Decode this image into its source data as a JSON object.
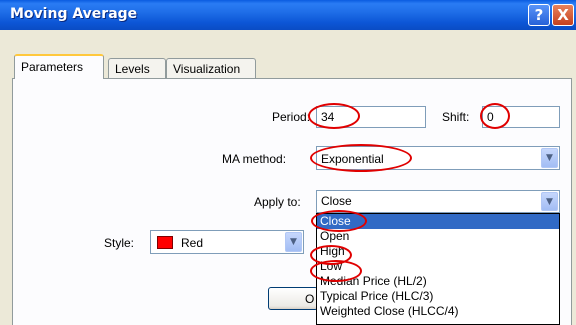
{
  "window": {
    "title": "Moving Average",
    "help_glyph": "?",
    "close_glyph": "X",
    "title_color": "#1f6ee8"
  },
  "tabs": [
    {
      "label": "Parameters",
      "active": true
    },
    {
      "label": "Levels",
      "active": false
    },
    {
      "label": "Visualization",
      "active": false
    }
  ],
  "form": {
    "period": {
      "label": "Period:",
      "value": "34"
    },
    "shift": {
      "label": "Shift:",
      "value": "0"
    },
    "ma_method": {
      "label": "MA method:",
      "value": "Exponential"
    },
    "apply_to": {
      "label": "Apply to:",
      "value": "Close",
      "options": [
        "Close",
        "Open",
        "High",
        "Low",
        "Median Price (HL/2)",
        "Typical Price (HLC/3)",
        "Weighted Close (HLCC/4)"
      ],
      "highlighted_option": "Close"
    },
    "style": {
      "label": "Style:",
      "color_name": "Red",
      "color": "#ff0000"
    }
  },
  "buttons": {
    "ok_label_partial": "O"
  },
  "annotation_color": "#e00000"
}
